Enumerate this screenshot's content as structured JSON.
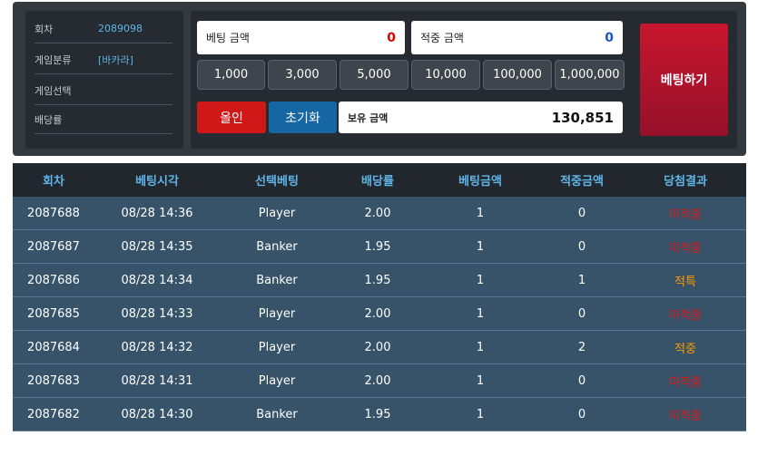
{
  "info": {
    "rows": [
      {
        "label": "회차",
        "value": "2089098"
      },
      {
        "label": "게임분류",
        "value": "[바카라]"
      },
      {
        "label": "게임선택",
        "value": ""
      },
      {
        "label": "배당률",
        "value": ""
      }
    ]
  },
  "bet": {
    "bet_amount_label": "베팅 금액",
    "bet_amount_value": "0",
    "win_amount_label": "적중 금액",
    "win_amount_value": "0",
    "chips": [
      "1,000",
      "3,000",
      "5,000",
      "10,000",
      "100,000",
      "1,000,000"
    ],
    "allin_label": "올인",
    "reset_label": "초기화",
    "holding_label": "보유 금액",
    "holding_value": "130,851",
    "submit_label": "베팅하기"
  },
  "colors": {
    "accent_blue": "#5fb4e8",
    "bet_red": "#c8162e",
    "lose_red": "#e01818",
    "win_orange": "#ff9800"
  },
  "history": {
    "headers": [
      "회차",
      "베팅시각",
      "선택베팅",
      "배당률",
      "베팅금액",
      "적중금액",
      "당첨결과"
    ],
    "rows": [
      {
        "round": "2087688",
        "time": "08/28 14:36",
        "pick": "Player",
        "odds": "2.00",
        "bet": "1",
        "win": "0",
        "result": "미적중",
        "status": "lose"
      },
      {
        "round": "2087687",
        "time": "08/28 14:35",
        "pick": "Banker",
        "odds": "1.95",
        "bet": "1",
        "win": "0",
        "result": "미적중",
        "status": "lose"
      },
      {
        "round": "2087686",
        "time": "08/28 14:34",
        "pick": "Banker",
        "odds": "1.95",
        "bet": "1",
        "win": "1",
        "result": "적특",
        "status": "win"
      },
      {
        "round": "2087685",
        "time": "08/28 14:33",
        "pick": "Player",
        "odds": "2.00",
        "bet": "1",
        "win": "0",
        "result": "미적중",
        "status": "lose"
      },
      {
        "round": "2087684",
        "time": "08/28 14:32",
        "pick": "Player",
        "odds": "2.00",
        "bet": "1",
        "win": "2",
        "result": "적중",
        "status": "win"
      },
      {
        "round": "2087683",
        "time": "08/28 14:31",
        "pick": "Player",
        "odds": "2.00",
        "bet": "1",
        "win": "0",
        "result": "미적중",
        "status": "lose"
      },
      {
        "round": "2087682",
        "time": "08/28 14:30",
        "pick": "Banker",
        "odds": "1.95",
        "bet": "1",
        "win": "0",
        "result": "미적중",
        "status": "lose"
      }
    ]
  }
}
